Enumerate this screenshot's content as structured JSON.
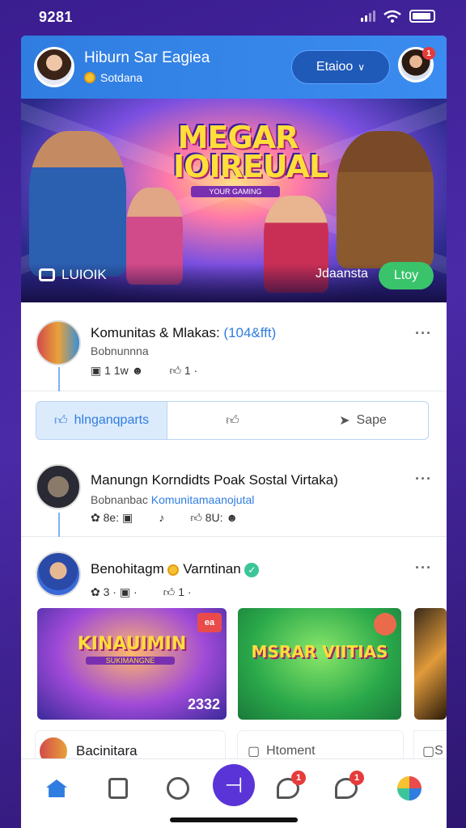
{
  "status": {
    "time": "9281"
  },
  "header": {
    "name": "Hiburn Sar Eagiea",
    "subtitle": "Sotdana",
    "pill_label": "Etaioo",
    "notif_count": "1"
  },
  "hero": {
    "title": "MEGAR IOIREUAL",
    "subtitle": "YOUR GAMING",
    "live_label": "LUIOIK",
    "tag": "Jdaansta",
    "play_label": "Ltoy"
  },
  "posts": [
    {
      "title": "Komunitas & Mlakas: ",
      "title_highlight": "(104&fft)",
      "meta": "Bobnunnna",
      "stat1": "1 1w",
      "stat2": "1"
    },
    {
      "title": "Manungn Korndidts Poak Sostal Virtaka)",
      "meta": "Bobnanbac ",
      "meta_highlight": "Komunitamaanojutal",
      "stat1": "8e:",
      "stat2": "",
      "stat3": "8U:"
    },
    {
      "title": "Benohitagm",
      "title_suffix": "Varntinan",
      "stat1": "3",
      "stat2": "1"
    }
  ],
  "actions": {
    "like_label": "hlnganqparts",
    "share_label": "Sape"
  },
  "thumbs": [
    {
      "title": "KINAUIMIN",
      "sub": "SUKIMANGNE",
      "corner": "ea",
      "count": "2332"
    },
    {
      "title": "MSRAR VIITIAS",
      "corner": ""
    }
  ],
  "lower": {
    "card1_label": "Bacinitara",
    "card2_label": "Htoment",
    "card3_label": "S"
  },
  "nav": {
    "badge1": "1",
    "badge2": "1"
  },
  "colors": {
    "accent": "#2f7de0",
    "fab": "#5b34d8",
    "play": "#39c46b",
    "badge": "#e63b3b"
  }
}
